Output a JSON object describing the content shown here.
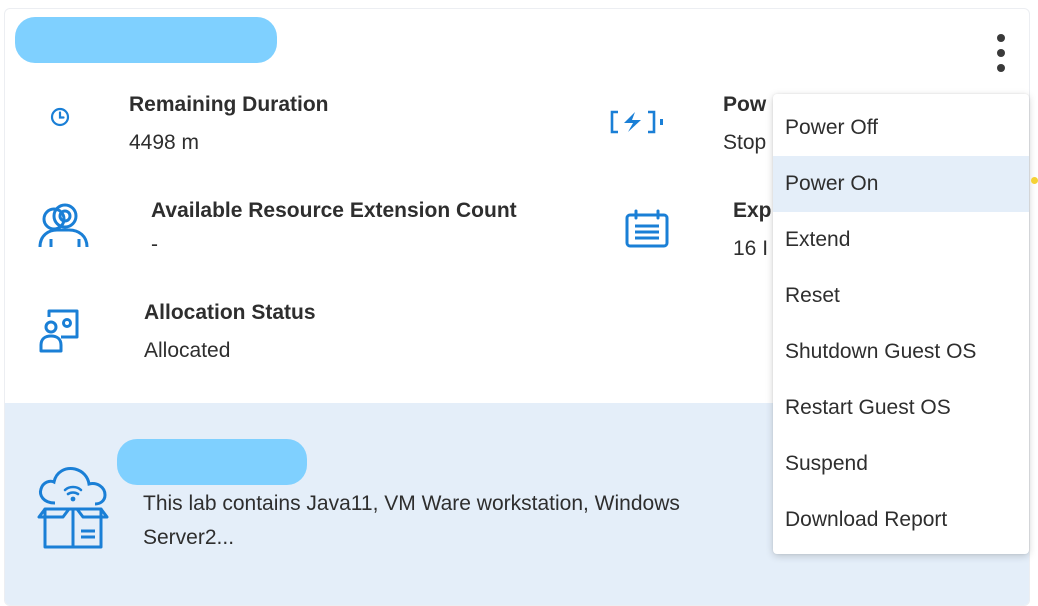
{
  "card": {
    "fields": {
      "remaining_duration": {
        "label": "Remaining Duration",
        "value": "4498 m"
      },
      "power": {
        "label": "Pow",
        "value": "Stop"
      },
      "available_extension": {
        "label": "Available Resource Extension Count",
        "value": "-"
      },
      "expiry": {
        "label": "Exp",
        "value": "16 I"
      },
      "allocation_status": {
        "label": "Allocation Status",
        "value": "Allocated"
      }
    },
    "lab": {
      "description": "This lab contains Java11, VM Ware workstation, Windows Server2..."
    }
  },
  "menu": {
    "items": [
      {
        "label": "Power Off"
      },
      {
        "label": "Power On"
      },
      {
        "label": "Extend"
      },
      {
        "label": "Reset"
      },
      {
        "label": "Shutdown Guest OS"
      },
      {
        "label": "Restart Guest OS"
      },
      {
        "label": "Suspend"
      },
      {
        "label": "Download Report"
      }
    ]
  },
  "colors": {
    "icon_blue": "#1a7fd6",
    "lower_panel": "#e4eef9",
    "menu_hover": "#e4eef9",
    "redaction": "#7fd0ff"
  }
}
